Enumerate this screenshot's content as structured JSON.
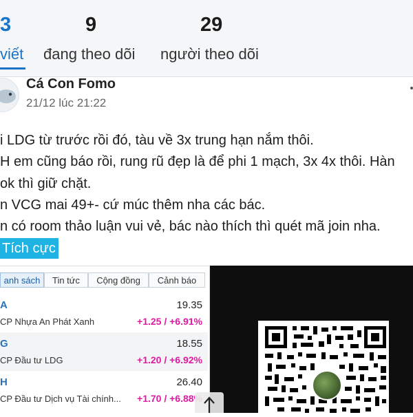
{
  "profile_stats": {
    "posts": {
      "count": "3",
      "label": "viết"
    },
    "following": {
      "count": "9",
      "label": "đang theo dõi"
    },
    "followers": {
      "count": "29",
      "label": "người theo dõi"
    }
  },
  "post": {
    "author": "Cá Con Fomo",
    "timestamp": "21/12 lúc 21:22",
    "lines": [
      "i LDG từ trước rồi đó, tàu về 3x trung hạn nắm thôi.",
      "H em cũng báo rồi, rung rũ đẹp là để phi 1 mạch, 3x 4x thôi. Hàn",
      " ok thì giữ chặt.",
      "n VCG mai 49+- cứ múc thêm nha các bác.",
      "n có room thảo luận vui vẻ, bác nào thích thì quét mã join nha."
    ],
    "sentiment_tag": "Tích cực"
  },
  "watchlist_widget": {
    "tabs": [
      "anh sách",
      "Tin tức",
      "Cộng đồng",
      "Cảnh báo"
    ],
    "active_tab": 0,
    "rows": [
      {
        "ticker": "A",
        "price": "19.35",
        "name": "CP Nhựa An Phát Xanh",
        "change": "+1.25 / +6.91%"
      },
      {
        "ticker": "G",
        "price": "18.55",
        "name": "CP Đầu tư LDG",
        "change": "+1.20 / +6.92%"
      },
      {
        "ticker": "H",
        "price": "26.40",
        "name": "CP Đầu tư Dịch vụ Tài chính...",
        "change": "+1.70 / +6.88%"
      }
    ]
  },
  "colors": {
    "accent": "#1a73c8",
    "tag_bg": "#1eb3e3",
    "gain": "#e01aa0"
  },
  "icons": {
    "avatar": "fish-avatar-icon",
    "more": "more-vertical-icon",
    "scroll_top": "arrow-up-icon",
    "qr": "qr-code"
  }
}
